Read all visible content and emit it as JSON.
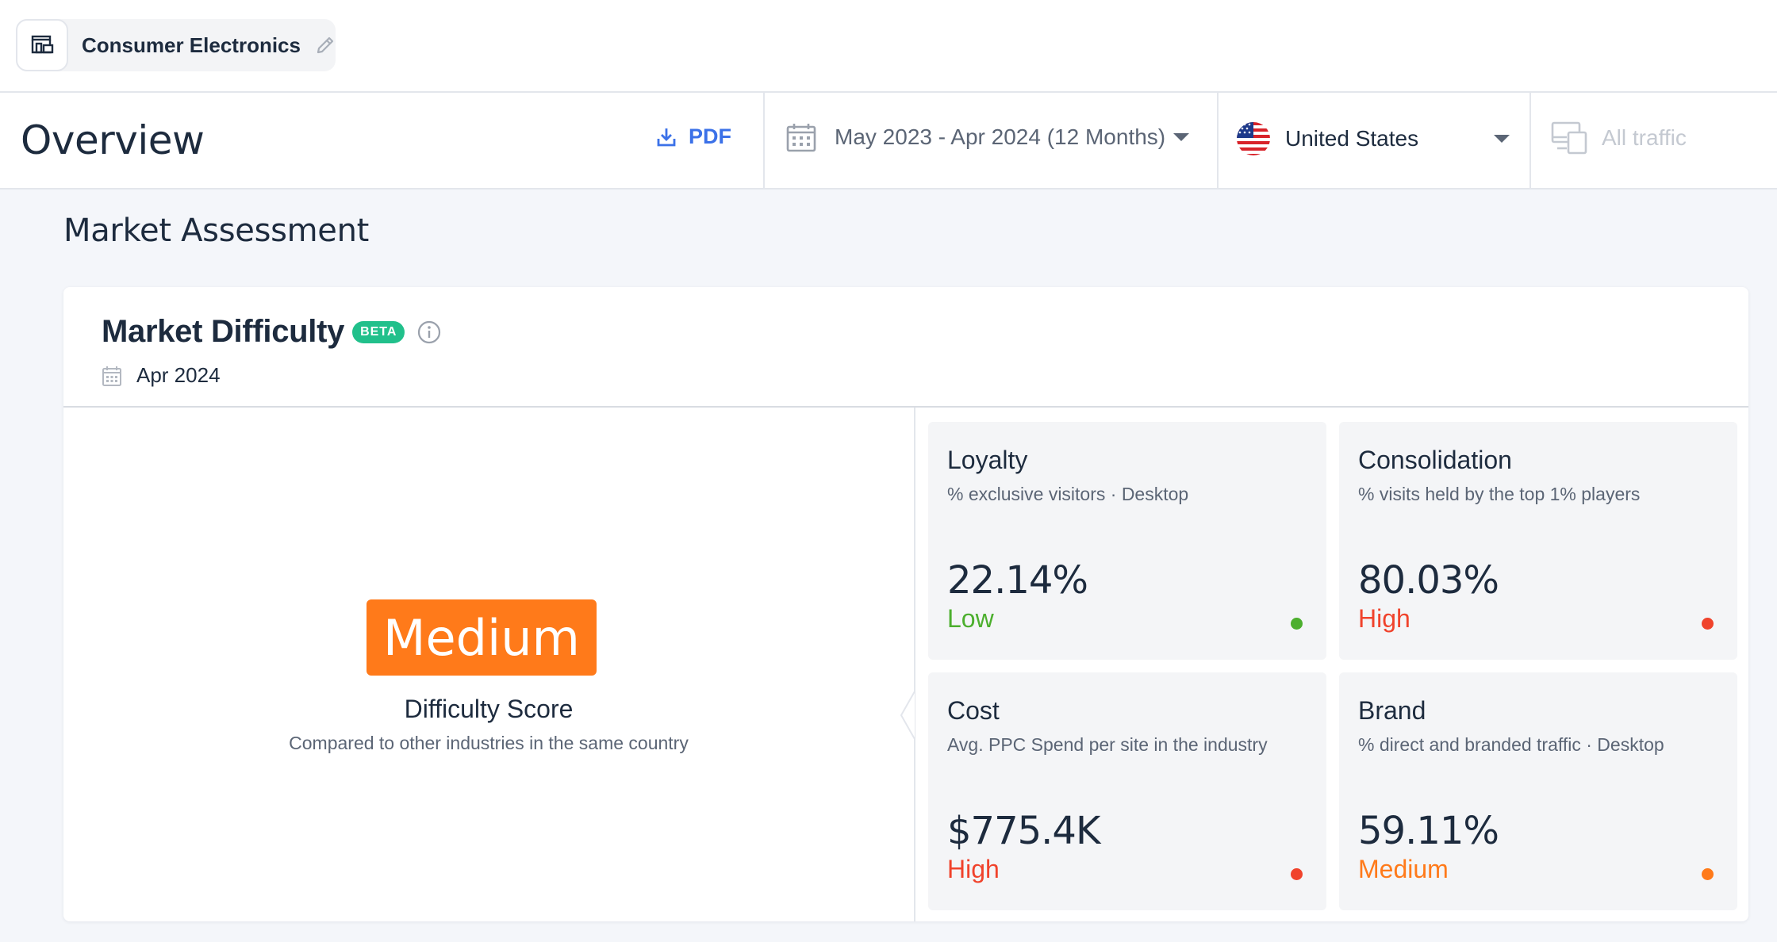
{
  "topbar": {
    "industry_name": "Consumer Electronics",
    "industry_icon": "store-icon",
    "edit_icon": "pencil-icon"
  },
  "header": {
    "title": "Overview",
    "pdf_label": "PDF",
    "date_range": "May 2023 - Apr 2024 (12 Months)",
    "country": "United States",
    "traffic": "All traffic"
  },
  "section": {
    "title": "Market Assessment"
  },
  "card": {
    "title": "Market Difficulty",
    "badge": "BETA",
    "date": "Apr 2024",
    "score": {
      "level": "Medium",
      "label": "Difficulty Score",
      "sub": "Compared to other industries in the same country",
      "color": "#ff7a1a"
    },
    "metrics": [
      {
        "title": "Loyalty",
        "sub": "% exclusive visitors · Desktop",
        "value": "22.14%",
        "level": "Low",
        "color": "#4caf2e"
      },
      {
        "title": "Consolidation",
        "sub": "% visits held by the top 1% players",
        "value": "80.03%",
        "level": "High",
        "color": "#f0432c"
      },
      {
        "title": "Cost",
        "sub": "Avg. PPC Spend per site in the industry",
        "value": "$775.4K",
        "level": "High",
        "color": "#f0432c"
      },
      {
        "title": "Brand",
        "sub": "% direct and branded traffic · Desktop",
        "value": "59.11%",
        "level": "Medium",
        "color": "#ff7a1a"
      }
    ]
  }
}
